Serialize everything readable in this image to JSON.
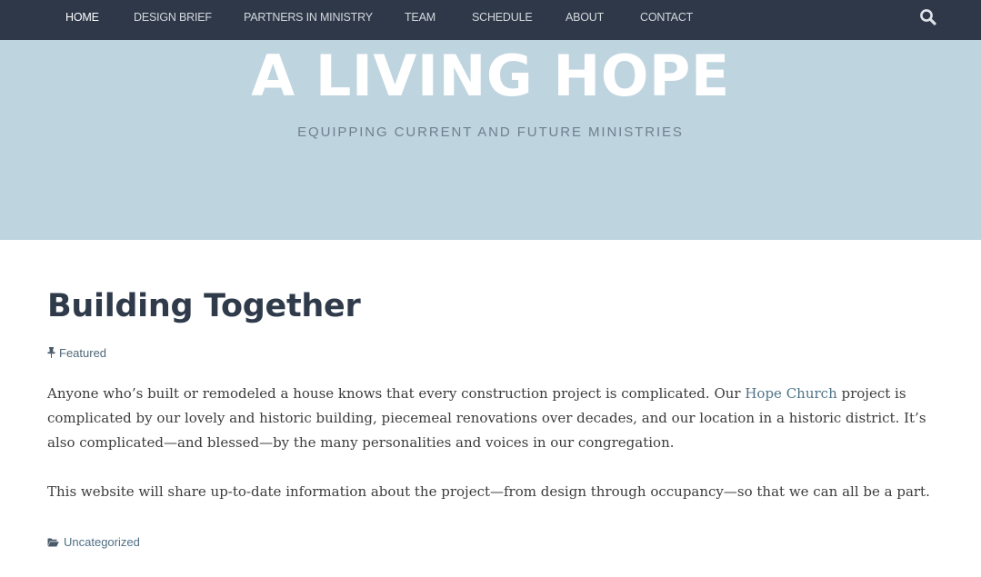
{
  "nav": {
    "items": [
      {
        "label": "HOME",
        "active": true
      },
      {
        "label": "DESIGN BRIEF"
      },
      {
        "label": "PARTNERS IN MINISTRY"
      },
      {
        "label": "TEAM"
      },
      {
        "label": "SCHEDULE"
      },
      {
        "label": "ABOUT"
      },
      {
        "label": "CONTACT"
      }
    ],
    "search_icon": "search-icon"
  },
  "hero": {
    "title": "A LIVING HOPE",
    "tagline": "EQUIPPING CURRENT AND FUTURE MINISTRIES"
  },
  "post": {
    "title": "Building Together",
    "meta_icon": "pin-icon",
    "meta_label": "Featured",
    "p1_before": "Anyone who’s built or remodeled a house knows that every construction project is complicated. Our ",
    "p1_link": "Hope Church",
    "p1_after": " project is complicated by our lovely and historic building, piecemeal renovations over decades, and our location in a historic district. It’s also complicated—and blessed—by the many personalities and voices in our congregation.",
    "p2": "This website will share up-to-date information about the project—from design through occupancy—so that we can all be a part.",
    "category_icon": "folder-open-icon",
    "category": "Uncategorized"
  },
  "colors": {
    "navbar": "#2e3848",
    "hero": "#bed4df",
    "title": "#2f3a4a",
    "link": "#4f7388"
  }
}
